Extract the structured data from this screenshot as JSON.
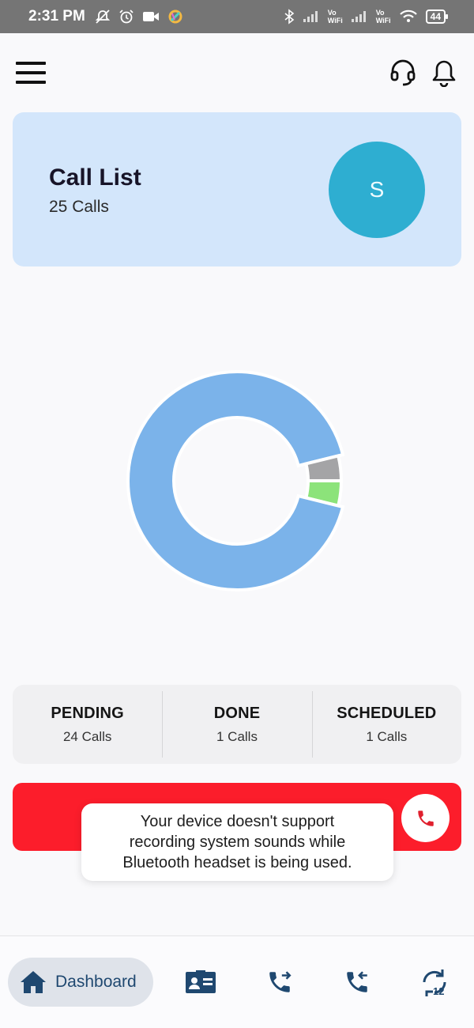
{
  "status_bar": {
    "time": "2:31 PM",
    "network_labels": [
      "Vo",
      "WiFi"
    ],
    "battery": "44"
  },
  "header": {
    "menu_icon": "hamburger-menu-icon",
    "support_icon": "headset-icon",
    "notification_icon": "bell-icon"
  },
  "call_card": {
    "title": "Call List",
    "subtitle": "25 Calls",
    "avatar_letter": "S"
  },
  "chart_data": {
    "type": "pie",
    "style": "donut",
    "total": 26,
    "slices": [
      {
        "name": "Pending",
        "value": 24,
        "color": "#7bb3ea"
      },
      {
        "name": "Scheduled",
        "value": 1,
        "color": "#a4a4a6"
      },
      {
        "name": "Done",
        "value": 1,
        "color": "#8ce37a"
      }
    ]
  },
  "stats": [
    {
      "label": "PENDING",
      "count": "24 Calls"
    },
    {
      "label": "DONE",
      "count": "1 Calls"
    },
    {
      "label": "SCHEDULED",
      "count": "1 Calls"
    }
  ],
  "call_bar": {
    "color": "#fc1d2b",
    "icon": "phone-icon"
  },
  "toast": {
    "message": "Your device doesn't support\nrecording system sounds while\nBluetooth headset is being used."
  },
  "bottom_nav": {
    "active_label": "Dashboard",
    "items": [
      "home-icon",
      "contact-card-icon",
      "outgoing-call-icon",
      "incoming-call-icon",
      "scheduled-12-icon"
    ],
    "scheduled_badge": "12"
  }
}
